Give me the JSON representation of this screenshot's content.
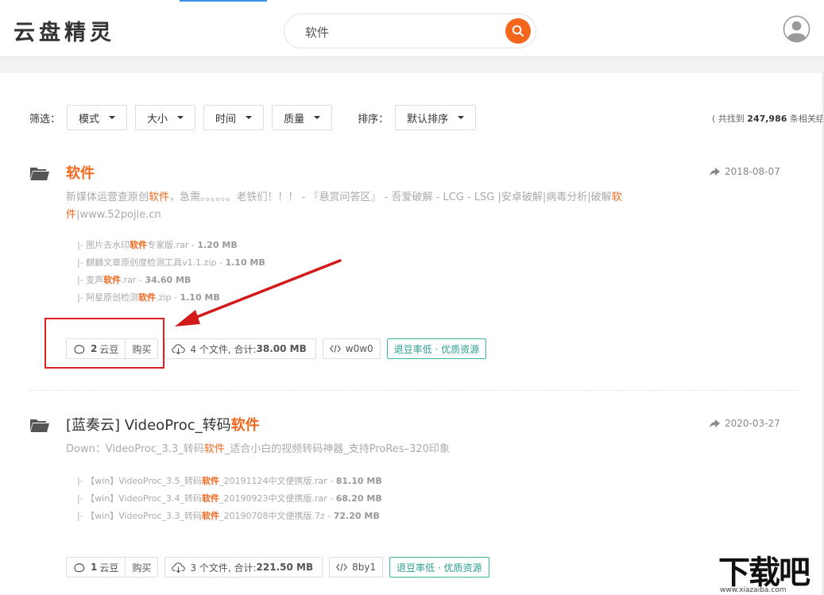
{
  "header": {
    "logo": "云盘精灵",
    "search_value": "软件"
  },
  "filters": {
    "label": "筛选：",
    "dropdowns": [
      "模式",
      "大小",
      "时间",
      "质量"
    ],
    "sort_label": "排序：",
    "sort_value": "默认排序",
    "found_prefix": "( 共找到 ",
    "found_count": "247,986",
    "found_suffix": " 条相关结"
  },
  "results": [
    {
      "title_pre": "",
      "title_hl": "软件",
      "title_post": "",
      "date": "2018-08-07",
      "desc_segments": [
        {
          "t": "新媒体运营查原创",
          "hl": false
        },
        {
          "t": "软件",
          "hl": true
        },
        {
          "t": "，急需。。。。。。老铁们！！！ - 『悬赏问答区』 - 吾爱破解 - LCG - LSG |安卓破解|病毒分析|",
          "hl": false
        },
        {
          "t": "破解",
          "hl": false
        },
        {
          "t": "软件",
          "hl": true
        },
        {
          "t": "|www.52pojie.cn",
          "hl": false
        }
      ],
      "files": [
        {
          "pre": "|- 图片去水印",
          "hl": "软件",
          "post": "专家版.rar - ",
          "size": "1.20 MB"
        },
        {
          "pre": "|- 麒麟文章原创度检测工具v1.1.zip - ",
          "hl": "",
          "post": "",
          "size": "1.10 MB"
        },
        {
          "pre": "|- 变声",
          "hl": "软件",
          "post": ".rar - ",
          "size": "34.60 MB"
        },
        {
          "pre": "|- 阿星原创检测",
          "hl": "软件",
          "post": ".zip - ",
          "size": "1.10 MB"
        }
      ],
      "coins_num": "2",
      "coins_unit": "云豆",
      "buy": "购买",
      "files_summary_pre": "4 个文件, 合计: ",
      "files_summary_size": "38.00 MB",
      "code": "w0w0",
      "tag": "退豆率低 · 优质资源"
    },
    {
      "title_pre": "[蓝奏云] VideoProc_转码",
      "title_hl": "软件",
      "title_post": "",
      "date": "2020-03-27",
      "desc_segments": [
        {
          "t": "Down：VideoProc_3.3_转码",
          "hl": false
        },
        {
          "t": "软件",
          "hl": true
        },
        {
          "t": "_适合小白的视频转码神器_支持ProRes–320印象",
          "hl": false
        }
      ],
      "files": [
        {
          "pre": "|- 【win】VideoProc_3.5_转码",
          "hl": "软件",
          "post": "_20191124中文便携版.rar - ",
          "size": "81.10 MB"
        },
        {
          "pre": "|- 【win】VideoProc_3.4_转码",
          "hl": "软件",
          "post": "_20190923中文便携版.rar - ",
          "size": "68.20 MB"
        },
        {
          "pre": "|- 【win】VideoProc_3.3_转码",
          "hl": "软件",
          "post": "_20190708中文便携版.7z - ",
          "size": "72.20 MB"
        }
      ],
      "coins_num": "1",
      "coins_unit": "云豆",
      "buy": "购买",
      "files_summary_pre": "3 个文件, 合计: ",
      "files_summary_size": "221.50 MB",
      "code": "8by1",
      "tag": "退豆率低 · 优质资源"
    }
  ],
  "watermark": {
    "text": "下载吧",
    "url": "www.xiazaiba.com"
  },
  "colors": {
    "accent": "#f4661c",
    "annotation": "#e02020",
    "tag": "#2a9d8f"
  }
}
